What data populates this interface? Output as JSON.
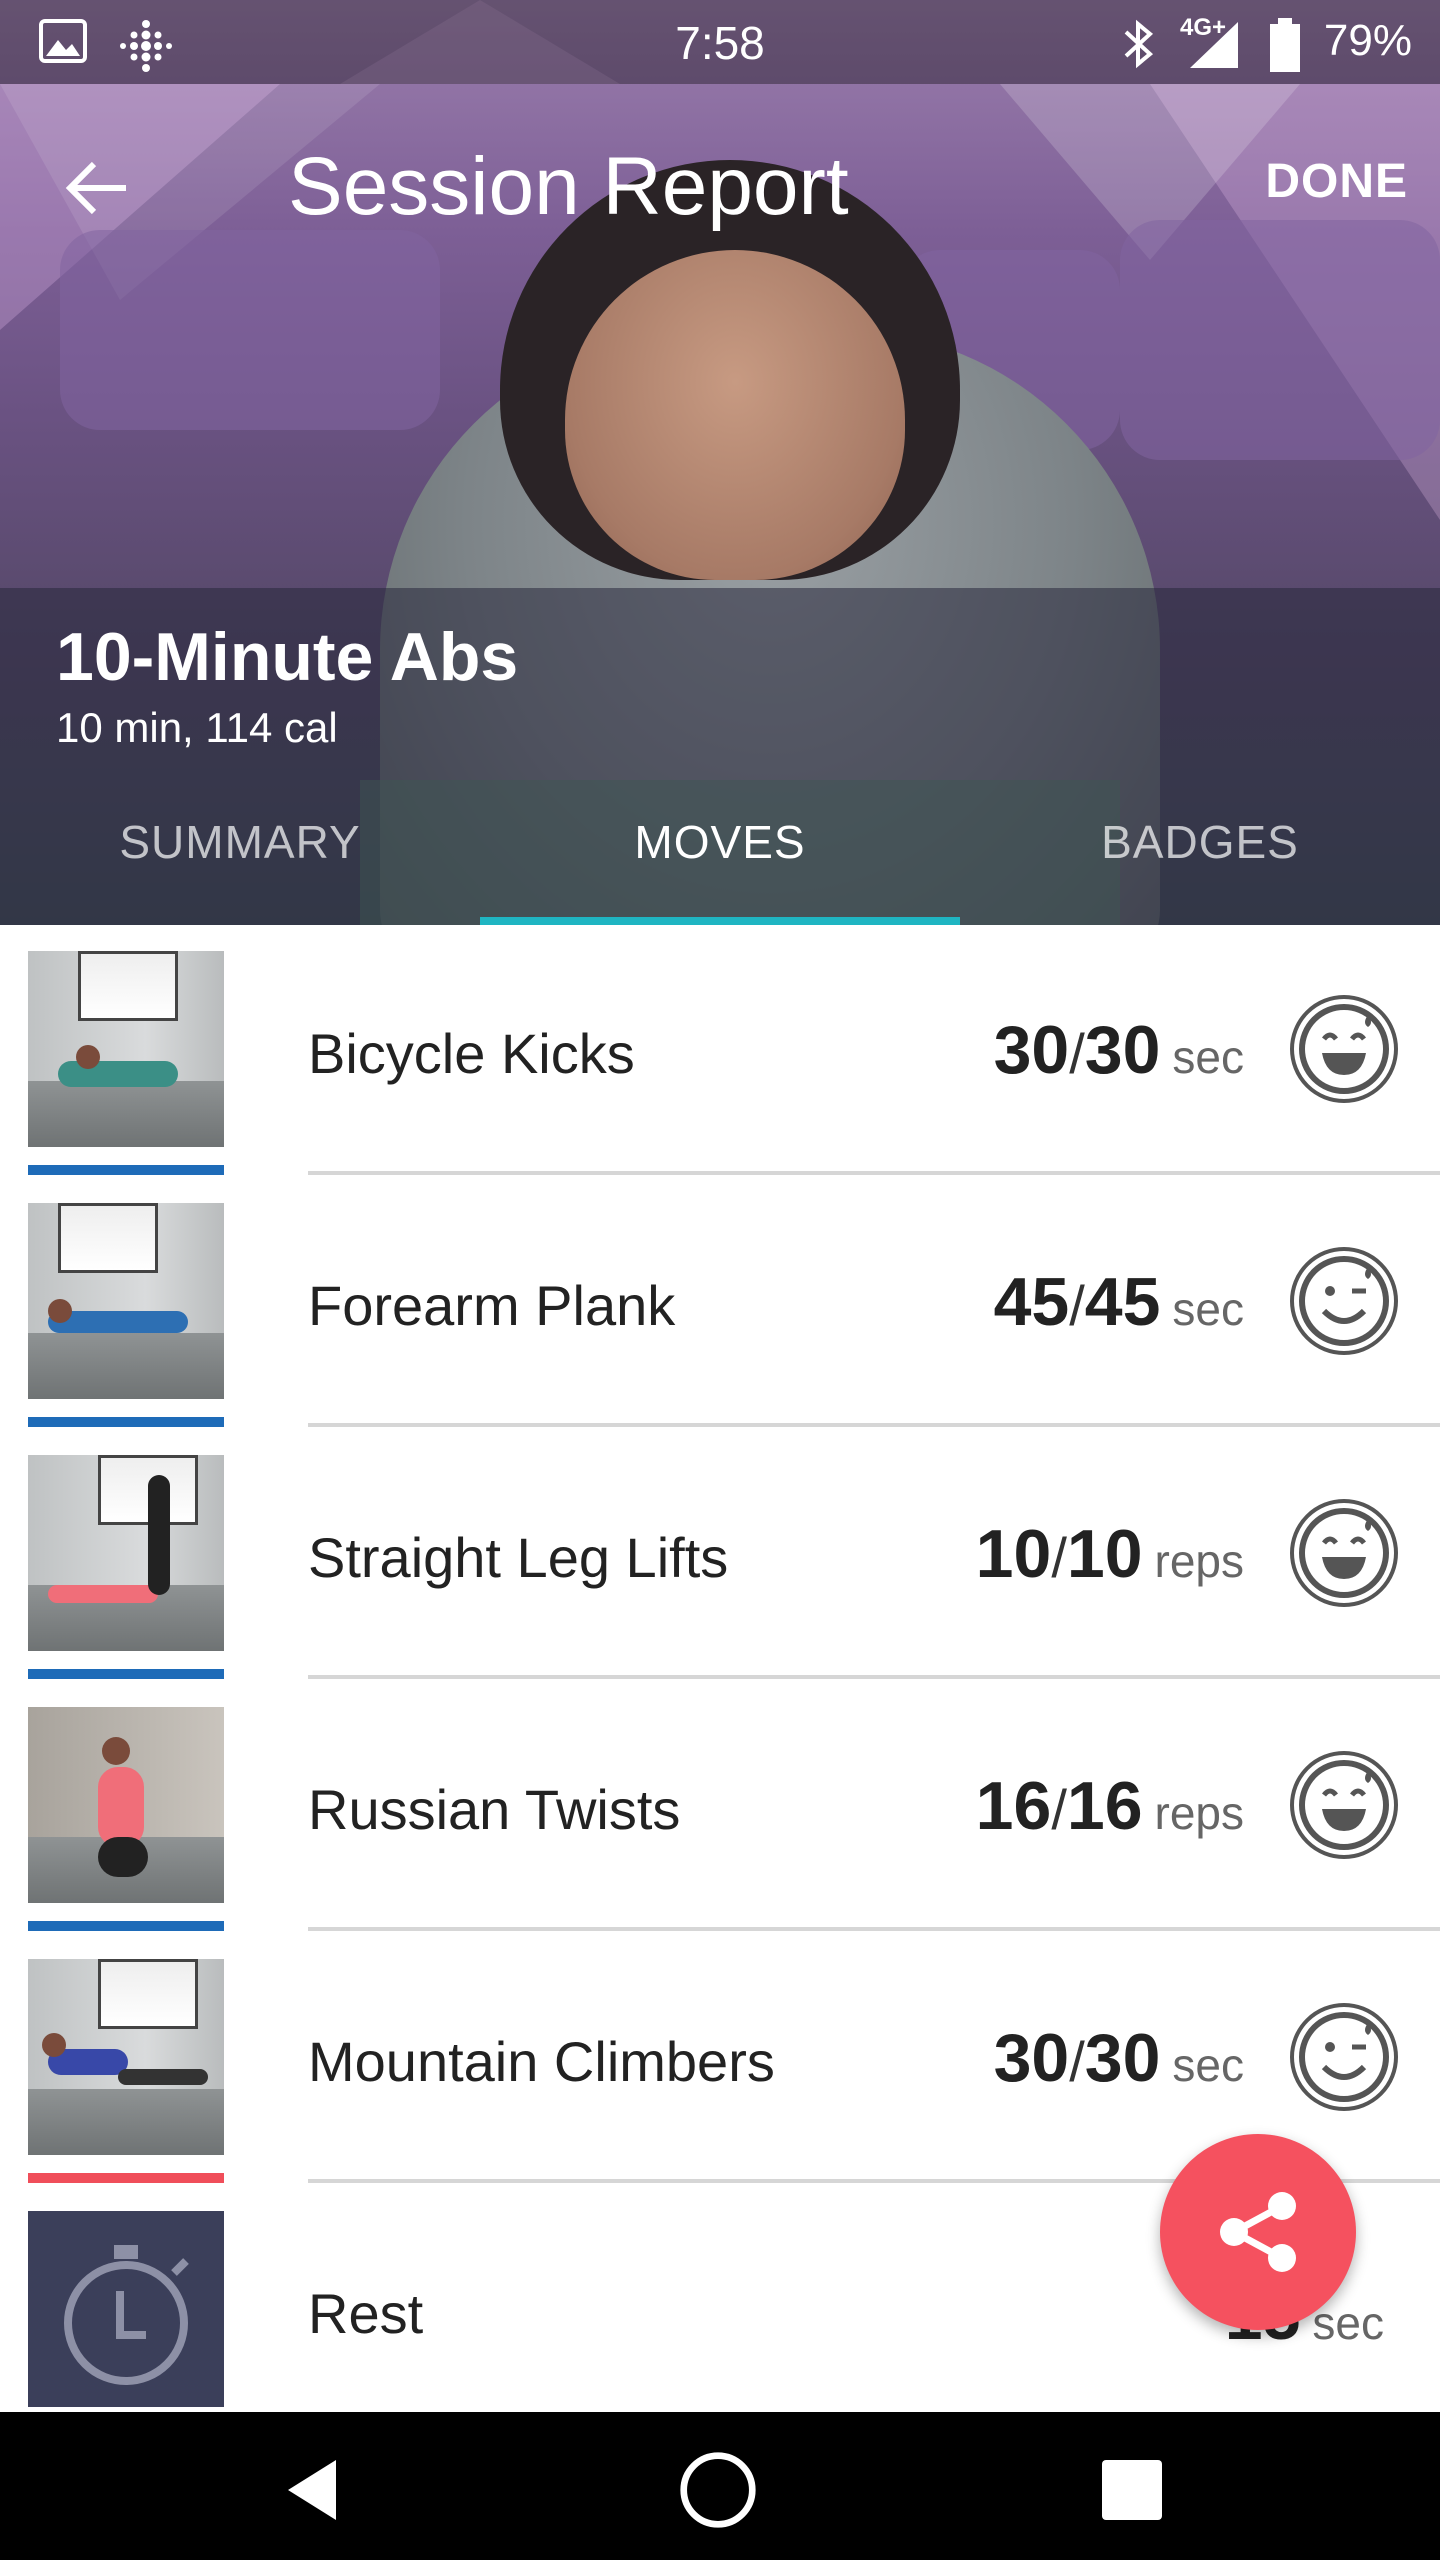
{
  "status_bar": {
    "time": "7:58",
    "battery_percent": "79%",
    "network": "4G+",
    "icons": [
      "image-icon",
      "fitbit-icon",
      "bluetooth-icon",
      "signal-icon",
      "battery-icon"
    ]
  },
  "toolbar": {
    "back_icon": "arrow-left-icon",
    "title": "Session Report",
    "done_label": "DONE"
  },
  "workout": {
    "title": "10-Minute Abs",
    "subtitle": "10 min, 114 cal"
  },
  "tabs": [
    {
      "label": "SUMMARY",
      "active": false
    },
    {
      "label": "MOVES",
      "active": true
    },
    {
      "label": "BADGES",
      "active": false
    }
  ],
  "moves": [
    {
      "name": "Bicycle Kicks",
      "done": "30",
      "target": "30",
      "unit": "sec",
      "face": "laughing-face-icon",
      "bar_color": "#1e6bb8"
    },
    {
      "name": "Forearm Plank",
      "done": "45",
      "target": "45",
      "unit": "sec",
      "face": "winking-face-icon",
      "bar_color": "#1e6bb8"
    },
    {
      "name": "Straight Leg Lifts",
      "done": "10",
      "target": "10",
      "unit": "reps",
      "face": "laughing-face-icon",
      "bar_color": "#1e6bb8"
    },
    {
      "name": "Russian Twists",
      "done": "16",
      "target": "16",
      "unit": "reps",
      "face": "laughing-face-icon",
      "bar_color": "#1e6bb8"
    },
    {
      "name": "Mountain Climbers",
      "done": "30",
      "target": "30",
      "unit": "sec",
      "face": "winking-face-icon",
      "bar_color": "#f04e5a"
    },
    {
      "name": "Rest",
      "done": "15",
      "target": "",
      "unit": "sec",
      "face": "",
      "bar_color": ""
    }
  ],
  "fab": {
    "icon": "share-icon",
    "color": "#f5515f"
  },
  "accent": "#1fb5c2",
  "nav": [
    "back-triangle-icon",
    "home-circle-icon",
    "recents-square-icon"
  ]
}
